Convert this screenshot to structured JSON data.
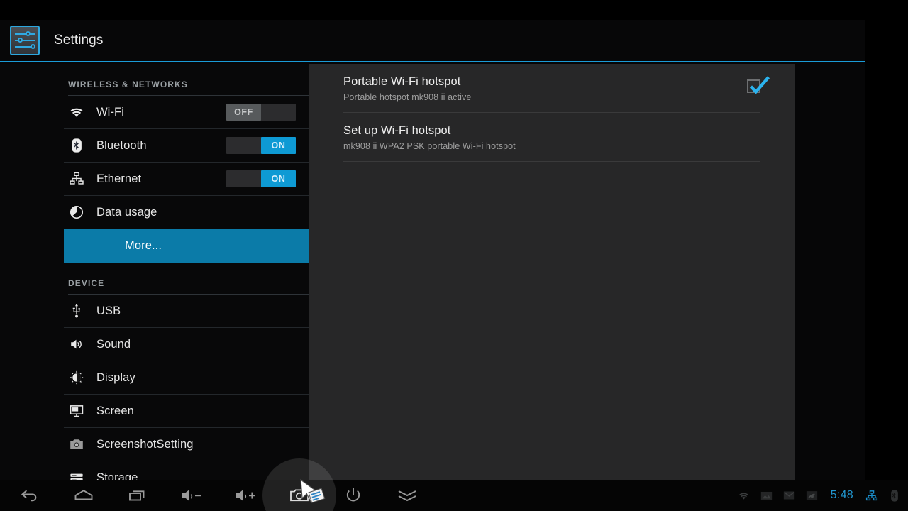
{
  "header": {
    "title": "Settings",
    "icon": "settings-sliders-icon",
    "accent": "#1a9bd7"
  },
  "sidebar": {
    "sections": [
      {
        "header": "WIRELESS & NETWORKS",
        "items": [
          {
            "label": "Wi-Fi",
            "icon": "wifi-icon",
            "toggle": "OFF",
            "toggle_state": "off"
          },
          {
            "label": "Bluetooth",
            "icon": "bluetooth-icon",
            "toggle": "ON",
            "toggle_state": "on"
          },
          {
            "label": "Ethernet",
            "icon": "ethernet-icon",
            "toggle": "ON",
            "toggle_state": "on"
          },
          {
            "label": "Data usage",
            "icon": "data-usage-icon",
            "toggle": null,
            "toggle_state": null
          },
          {
            "label": "More...",
            "icon": null,
            "toggle": null,
            "toggle_state": null,
            "selected": true
          }
        ]
      },
      {
        "header": "DEVICE",
        "items": [
          {
            "label": "USB",
            "icon": "usb-icon"
          },
          {
            "label": "Sound",
            "icon": "sound-icon"
          },
          {
            "label": "Display",
            "icon": "display-icon"
          },
          {
            "label": "Screen",
            "icon": "screen-icon"
          },
          {
            "label": "ScreenshotSetting",
            "icon": "camera-icon"
          },
          {
            "label": "Storage",
            "icon": "storage-icon"
          }
        ]
      }
    ],
    "selected_color": "#0b7ba8"
  },
  "content": {
    "items": [
      {
        "title": "Portable Wi-Fi hotspot",
        "summary": "Portable hotspot mk908 ii active",
        "checkbox": true
      },
      {
        "title": "Set up Wi-Fi hotspot",
        "summary": "mk908 ii WPA2 PSK portable Wi-Fi hotspot",
        "checkbox": false
      }
    ],
    "checkbox_color": "#2bb3ee"
  },
  "navbar": {
    "buttons": [
      {
        "name": "back",
        "icon": "back-arrow-icon"
      },
      {
        "name": "home",
        "icon": "home-icon"
      },
      {
        "name": "recents",
        "icon": "recents-icon"
      },
      {
        "name": "volume-down",
        "icon": "volume-down-icon"
      },
      {
        "name": "volume-up",
        "icon": "volume-up-icon"
      },
      {
        "name": "screenshot",
        "icon": "camera-icon",
        "highlighted": true
      },
      {
        "name": "power",
        "icon": "power-icon"
      },
      {
        "name": "hide-bar",
        "icon": "chevron-double-down-icon"
      }
    ],
    "status": {
      "icons": [
        "wifi-status-icon",
        "image-status-icon",
        "mail-status-icon",
        "call-status-icon"
      ],
      "clock": "5:48",
      "trailing_icons": [
        "ethernet-status-icon",
        "bluetooth-status-icon"
      ],
      "clock_color": "#2196cf",
      "active_icon_color": "#1a8fcc"
    }
  }
}
